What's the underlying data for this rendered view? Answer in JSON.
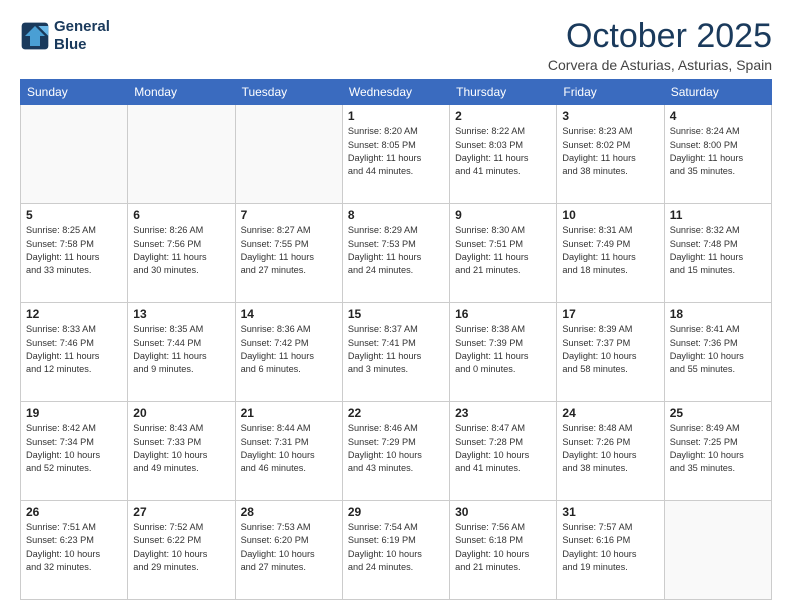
{
  "logo": {
    "line1": "General",
    "line2": "Blue"
  },
  "title": "October 2025",
  "location": "Corvera de Asturias, Asturias, Spain",
  "days_header": [
    "Sunday",
    "Monday",
    "Tuesday",
    "Wednesday",
    "Thursday",
    "Friday",
    "Saturday"
  ],
  "weeks": [
    [
      {
        "day": "",
        "info": ""
      },
      {
        "day": "",
        "info": ""
      },
      {
        "day": "",
        "info": ""
      },
      {
        "day": "1",
        "info": "Sunrise: 8:20 AM\nSunset: 8:05 PM\nDaylight: 11 hours\nand 44 minutes."
      },
      {
        "day": "2",
        "info": "Sunrise: 8:22 AM\nSunset: 8:03 PM\nDaylight: 11 hours\nand 41 minutes."
      },
      {
        "day": "3",
        "info": "Sunrise: 8:23 AM\nSunset: 8:02 PM\nDaylight: 11 hours\nand 38 minutes."
      },
      {
        "day": "4",
        "info": "Sunrise: 8:24 AM\nSunset: 8:00 PM\nDaylight: 11 hours\nand 35 minutes."
      }
    ],
    [
      {
        "day": "5",
        "info": "Sunrise: 8:25 AM\nSunset: 7:58 PM\nDaylight: 11 hours\nand 33 minutes."
      },
      {
        "day": "6",
        "info": "Sunrise: 8:26 AM\nSunset: 7:56 PM\nDaylight: 11 hours\nand 30 minutes."
      },
      {
        "day": "7",
        "info": "Sunrise: 8:27 AM\nSunset: 7:55 PM\nDaylight: 11 hours\nand 27 minutes."
      },
      {
        "day": "8",
        "info": "Sunrise: 8:29 AM\nSunset: 7:53 PM\nDaylight: 11 hours\nand 24 minutes."
      },
      {
        "day": "9",
        "info": "Sunrise: 8:30 AM\nSunset: 7:51 PM\nDaylight: 11 hours\nand 21 minutes."
      },
      {
        "day": "10",
        "info": "Sunrise: 8:31 AM\nSunset: 7:49 PM\nDaylight: 11 hours\nand 18 minutes."
      },
      {
        "day": "11",
        "info": "Sunrise: 8:32 AM\nSunset: 7:48 PM\nDaylight: 11 hours\nand 15 minutes."
      }
    ],
    [
      {
        "day": "12",
        "info": "Sunrise: 8:33 AM\nSunset: 7:46 PM\nDaylight: 11 hours\nand 12 minutes."
      },
      {
        "day": "13",
        "info": "Sunrise: 8:35 AM\nSunset: 7:44 PM\nDaylight: 11 hours\nand 9 minutes."
      },
      {
        "day": "14",
        "info": "Sunrise: 8:36 AM\nSunset: 7:42 PM\nDaylight: 11 hours\nand 6 minutes."
      },
      {
        "day": "15",
        "info": "Sunrise: 8:37 AM\nSunset: 7:41 PM\nDaylight: 11 hours\nand 3 minutes."
      },
      {
        "day": "16",
        "info": "Sunrise: 8:38 AM\nSunset: 7:39 PM\nDaylight: 11 hours\nand 0 minutes."
      },
      {
        "day": "17",
        "info": "Sunrise: 8:39 AM\nSunset: 7:37 PM\nDaylight: 10 hours\nand 58 minutes."
      },
      {
        "day": "18",
        "info": "Sunrise: 8:41 AM\nSunset: 7:36 PM\nDaylight: 10 hours\nand 55 minutes."
      }
    ],
    [
      {
        "day": "19",
        "info": "Sunrise: 8:42 AM\nSunset: 7:34 PM\nDaylight: 10 hours\nand 52 minutes."
      },
      {
        "day": "20",
        "info": "Sunrise: 8:43 AM\nSunset: 7:33 PM\nDaylight: 10 hours\nand 49 minutes."
      },
      {
        "day": "21",
        "info": "Sunrise: 8:44 AM\nSunset: 7:31 PM\nDaylight: 10 hours\nand 46 minutes."
      },
      {
        "day": "22",
        "info": "Sunrise: 8:46 AM\nSunset: 7:29 PM\nDaylight: 10 hours\nand 43 minutes."
      },
      {
        "day": "23",
        "info": "Sunrise: 8:47 AM\nSunset: 7:28 PM\nDaylight: 10 hours\nand 41 minutes."
      },
      {
        "day": "24",
        "info": "Sunrise: 8:48 AM\nSunset: 7:26 PM\nDaylight: 10 hours\nand 38 minutes."
      },
      {
        "day": "25",
        "info": "Sunrise: 8:49 AM\nSunset: 7:25 PM\nDaylight: 10 hours\nand 35 minutes."
      }
    ],
    [
      {
        "day": "26",
        "info": "Sunrise: 7:51 AM\nSunset: 6:23 PM\nDaylight: 10 hours\nand 32 minutes."
      },
      {
        "day": "27",
        "info": "Sunrise: 7:52 AM\nSunset: 6:22 PM\nDaylight: 10 hours\nand 29 minutes."
      },
      {
        "day": "28",
        "info": "Sunrise: 7:53 AM\nSunset: 6:20 PM\nDaylight: 10 hours\nand 27 minutes."
      },
      {
        "day": "29",
        "info": "Sunrise: 7:54 AM\nSunset: 6:19 PM\nDaylight: 10 hours\nand 24 minutes."
      },
      {
        "day": "30",
        "info": "Sunrise: 7:56 AM\nSunset: 6:18 PM\nDaylight: 10 hours\nand 21 minutes."
      },
      {
        "day": "31",
        "info": "Sunrise: 7:57 AM\nSunset: 6:16 PM\nDaylight: 10 hours\nand 19 minutes."
      },
      {
        "day": "",
        "info": ""
      }
    ]
  ]
}
